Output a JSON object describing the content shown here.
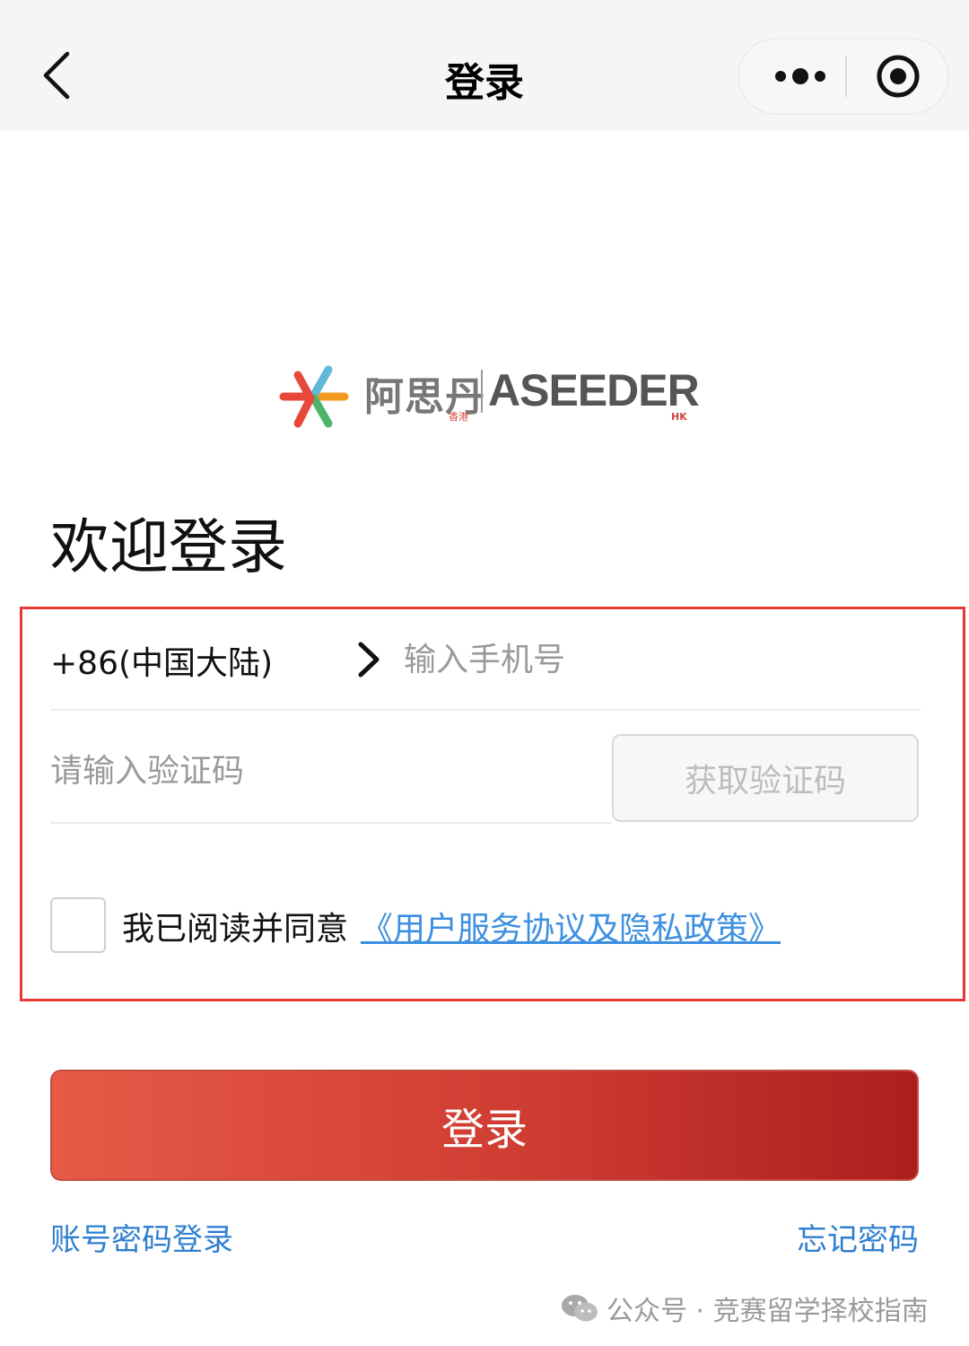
{
  "nav": {
    "title": "登录",
    "back_icon": "chevron-left-icon",
    "more_icon": "more-dots-icon",
    "close_icon": "target-close-icon"
  },
  "logo": {
    "cn_name": "阿思丹",
    "cn_sub": "香港",
    "en_name": "ASEEDER",
    "en_sub": "HK"
  },
  "welcome_title": "欢迎登录",
  "form": {
    "country_code": "+86(中国大陆)",
    "phone_placeholder": "输入手机号",
    "code_placeholder": "请输入验证码",
    "get_code_label": "获取验证码",
    "agree_text": "我已阅读并同意",
    "agree_link": "《用户服务协议及隐私政策》",
    "checked": false
  },
  "login_button": "登录",
  "links": {
    "password_login": "账号密码登录",
    "forgot_password": "忘记密码"
  },
  "watermark": "公众号 · 竞赛留学择校指南",
  "colors": {
    "accent_red": "#cf3c32",
    "link_blue": "#2f7fd0",
    "highlight_border": "#e53935"
  }
}
